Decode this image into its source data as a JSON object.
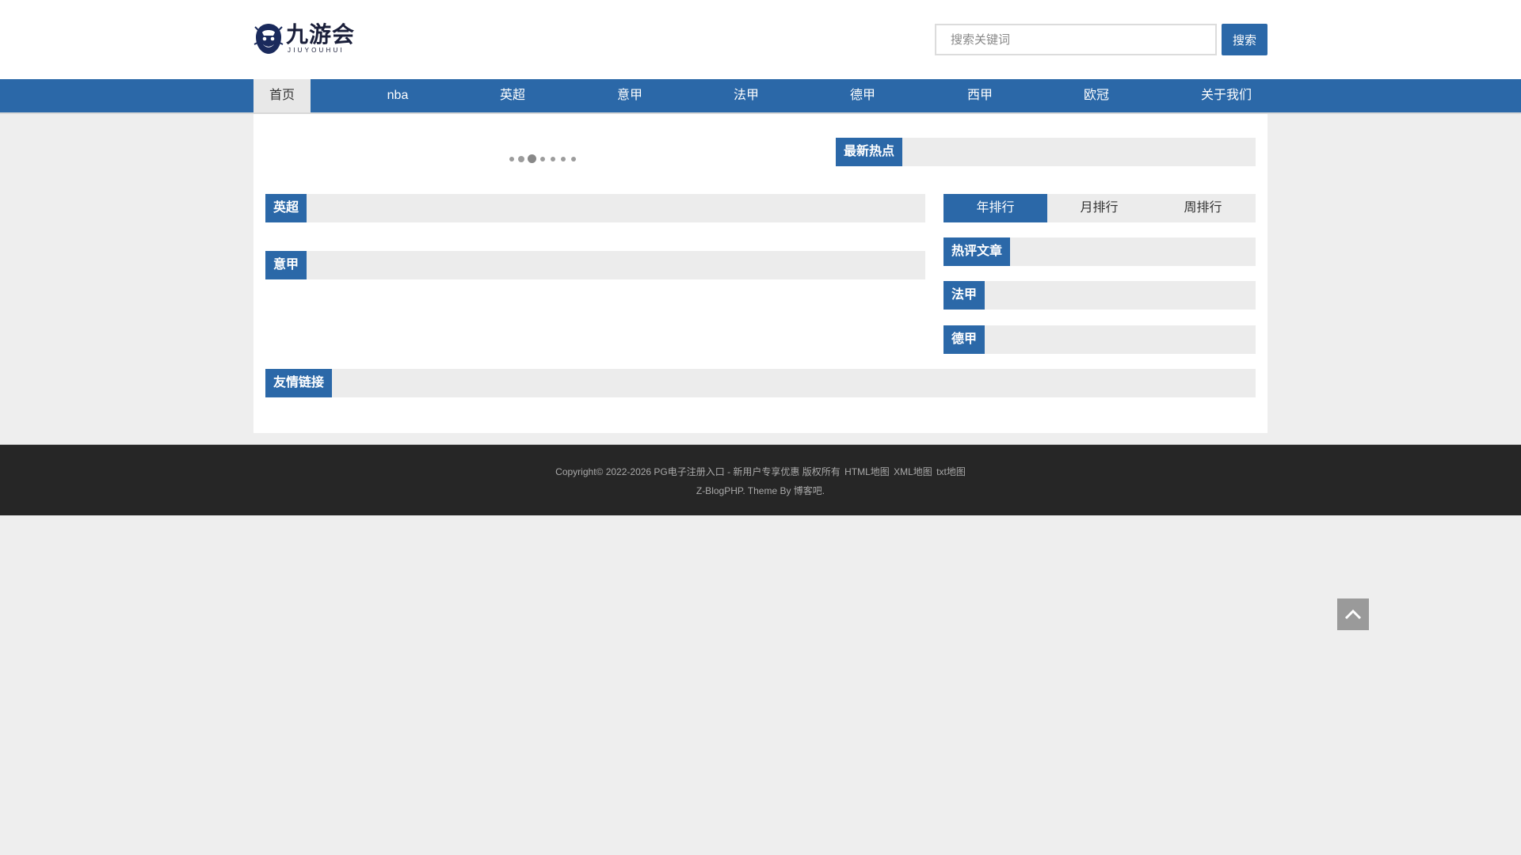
{
  "header": {
    "logo_cn": "九游会",
    "logo_en": "JIUYOUHUI",
    "search_placeholder": "搜索关键词",
    "search_button": "搜索"
  },
  "nav": {
    "items": [
      {
        "label": "首页",
        "active": true
      },
      {
        "label": "nba"
      },
      {
        "label": "英超"
      },
      {
        "label": "意甲"
      },
      {
        "label": "法甲"
      },
      {
        "label": "德甲"
      },
      {
        "label": "西甲"
      },
      {
        "label": "欧冠"
      },
      {
        "label": "关于我们"
      }
    ]
  },
  "slider": {
    "dot_count": 7,
    "active_index": 2
  },
  "sections": {
    "latest_hot": "最新热点",
    "premier_league": "英超",
    "serie_a": "意甲",
    "hot_comments": "热评文章",
    "ligue1": "法甲",
    "bundesliga": "德甲",
    "friend_links": "友情链接"
  },
  "ranking_tabs": [
    {
      "label": "年排行",
      "active": true
    },
    {
      "label": "月排行"
    },
    {
      "label": "周排行"
    }
  ],
  "footer": {
    "copyright": "Copyright© 2022-2026 PG电子注册入口 - 新用户专享优惠 版权所有",
    "links": [
      "HTML地图",
      "XML地图",
      "txt地图"
    ],
    "powered": "Z-BlogPHP. Theme By 博客吧."
  },
  "colors": {
    "brand": "#2b68a8",
    "footer_bg": "#262626",
    "page_bg": "#eeeeee"
  },
  "icons": {
    "logo": "lion-head-logo-icon",
    "back_to_top": "chevron-up-icon"
  }
}
